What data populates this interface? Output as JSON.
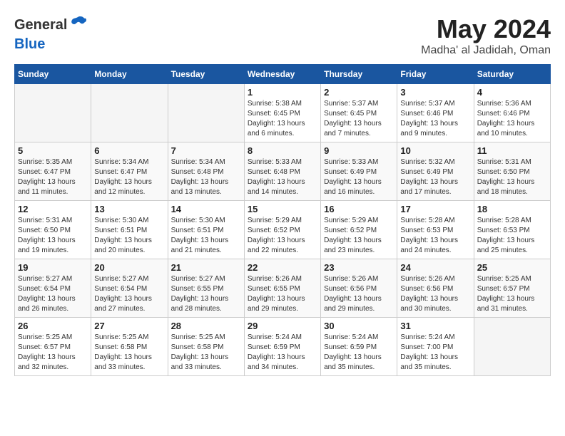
{
  "header": {
    "logo_general": "General",
    "logo_blue": "Blue",
    "month_year": "May 2024",
    "location": "Madha' al Jadidah, Oman"
  },
  "weekdays": [
    "Sunday",
    "Monday",
    "Tuesday",
    "Wednesday",
    "Thursday",
    "Friday",
    "Saturday"
  ],
  "weeks": [
    [
      {
        "day": "",
        "info": ""
      },
      {
        "day": "",
        "info": ""
      },
      {
        "day": "",
        "info": ""
      },
      {
        "day": "1",
        "info": "Sunrise: 5:38 AM\nSunset: 6:45 PM\nDaylight: 13 hours\nand 6 minutes."
      },
      {
        "day": "2",
        "info": "Sunrise: 5:37 AM\nSunset: 6:45 PM\nDaylight: 13 hours\nand 7 minutes."
      },
      {
        "day": "3",
        "info": "Sunrise: 5:37 AM\nSunset: 6:46 PM\nDaylight: 13 hours\nand 9 minutes."
      },
      {
        "day": "4",
        "info": "Sunrise: 5:36 AM\nSunset: 6:46 PM\nDaylight: 13 hours\nand 10 minutes."
      }
    ],
    [
      {
        "day": "5",
        "info": "Sunrise: 5:35 AM\nSunset: 6:47 PM\nDaylight: 13 hours\nand 11 minutes."
      },
      {
        "day": "6",
        "info": "Sunrise: 5:34 AM\nSunset: 6:47 PM\nDaylight: 13 hours\nand 12 minutes."
      },
      {
        "day": "7",
        "info": "Sunrise: 5:34 AM\nSunset: 6:48 PM\nDaylight: 13 hours\nand 13 minutes."
      },
      {
        "day": "8",
        "info": "Sunrise: 5:33 AM\nSunset: 6:48 PM\nDaylight: 13 hours\nand 14 minutes."
      },
      {
        "day": "9",
        "info": "Sunrise: 5:33 AM\nSunset: 6:49 PM\nDaylight: 13 hours\nand 16 minutes."
      },
      {
        "day": "10",
        "info": "Sunrise: 5:32 AM\nSunset: 6:49 PM\nDaylight: 13 hours\nand 17 minutes."
      },
      {
        "day": "11",
        "info": "Sunrise: 5:31 AM\nSunset: 6:50 PM\nDaylight: 13 hours\nand 18 minutes."
      }
    ],
    [
      {
        "day": "12",
        "info": "Sunrise: 5:31 AM\nSunset: 6:50 PM\nDaylight: 13 hours\nand 19 minutes."
      },
      {
        "day": "13",
        "info": "Sunrise: 5:30 AM\nSunset: 6:51 PM\nDaylight: 13 hours\nand 20 minutes."
      },
      {
        "day": "14",
        "info": "Sunrise: 5:30 AM\nSunset: 6:51 PM\nDaylight: 13 hours\nand 21 minutes."
      },
      {
        "day": "15",
        "info": "Sunrise: 5:29 AM\nSunset: 6:52 PM\nDaylight: 13 hours\nand 22 minutes."
      },
      {
        "day": "16",
        "info": "Sunrise: 5:29 AM\nSunset: 6:52 PM\nDaylight: 13 hours\nand 23 minutes."
      },
      {
        "day": "17",
        "info": "Sunrise: 5:28 AM\nSunset: 6:53 PM\nDaylight: 13 hours\nand 24 minutes."
      },
      {
        "day": "18",
        "info": "Sunrise: 5:28 AM\nSunset: 6:53 PM\nDaylight: 13 hours\nand 25 minutes."
      }
    ],
    [
      {
        "day": "19",
        "info": "Sunrise: 5:27 AM\nSunset: 6:54 PM\nDaylight: 13 hours\nand 26 minutes."
      },
      {
        "day": "20",
        "info": "Sunrise: 5:27 AM\nSunset: 6:54 PM\nDaylight: 13 hours\nand 27 minutes."
      },
      {
        "day": "21",
        "info": "Sunrise: 5:27 AM\nSunset: 6:55 PM\nDaylight: 13 hours\nand 28 minutes."
      },
      {
        "day": "22",
        "info": "Sunrise: 5:26 AM\nSunset: 6:55 PM\nDaylight: 13 hours\nand 29 minutes."
      },
      {
        "day": "23",
        "info": "Sunrise: 5:26 AM\nSunset: 6:56 PM\nDaylight: 13 hours\nand 29 minutes."
      },
      {
        "day": "24",
        "info": "Sunrise: 5:26 AM\nSunset: 6:56 PM\nDaylight: 13 hours\nand 30 minutes."
      },
      {
        "day": "25",
        "info": "Sunrise: 5:25 AM\nSunset: 6:57 PM\nDaylight: 13 hours\nand 31 minutes."
      }
    ],
    [
      {
        "day": "26",
        "info": "Sunrise: 5:25 AM\nSunset: 6:57 PM\nDaylight: 13 hours\nand 32 minutes."
      },
      {
        "day": "27",
        "info": "Sunrise: 5:25 AM\nSunset: 6:58 PM\nDaylight: 13 hours\nand 33 minutes."
      },
      {
        "day": "28",
        "info": "Sunrise: 5:25 AM\nSunset: 6:58 PM\nDaylight: 13 hours\nand 33 minutes."
      },
      {
        "day": "29",
        "info": "Sunrise: 5:24 AM\nSunset: 6:59 PM\nDaylight: 13 hours\nand 34 minutes."
      },
      {
        "day": "30",
        "info": "Sunrise: 5:24 AM\nSunset: 6:59 PM\nDaylight: 13 hours\nand 35 minutes."
      },
      {
        "day": "31",
        "info": "Sunrise: 5:24 AM\nSunset: 7:00 PM\nDaylight: 13 hours\nand 35 minutes."
      },
      {
        "day": "",
        "info": ""
      }
    ]
  ]
}
